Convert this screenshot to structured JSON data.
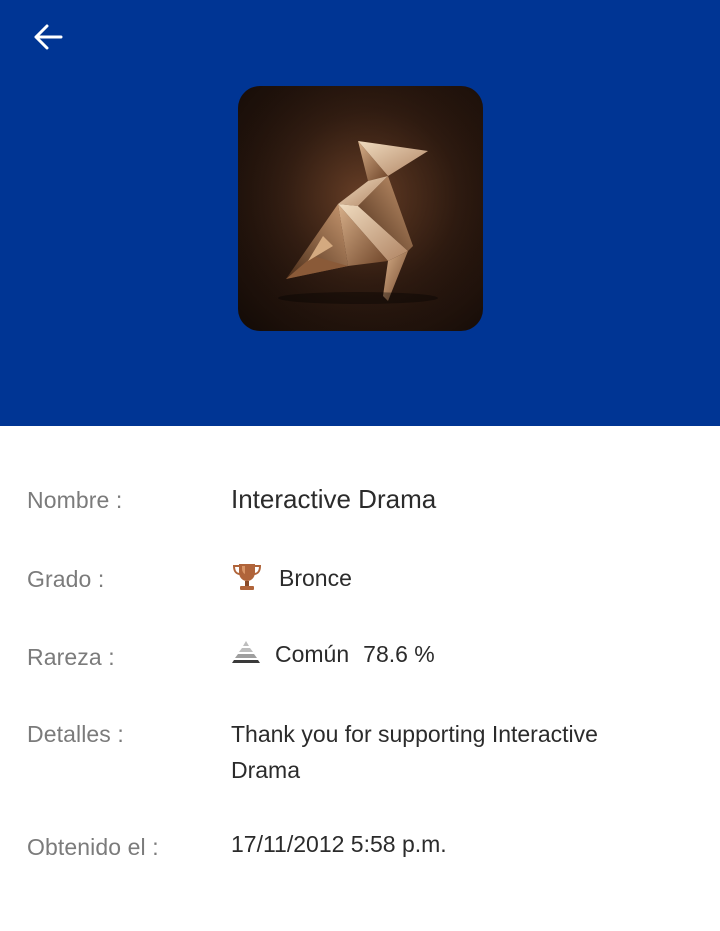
{
  "header": {
    "background": "#003594",
    "back_icon": "arrow-left-icon",
    "trophy_image": "origami-unicorn-trophy-art"
  },
  "fields": {
    "name": {
      "label": "Nombre :",
      "value": "Interactive Drama"
    },
    "grade": {
      "label": "Grado :",
      "value": "Bronce",
      "icon": "bronze-trophy-icon",
      "color": "#b0643a"
    },
    "rarity": {
      "label": "Rareza :",
      "value": "Común",
      "percent": "78.6 %",
      "icon": "pyramid-rarity-icon"
    },
    "details": {
      "label": "Detalles :",
      "value": "Thank you for supporting Interactive Drama"
    },
    "earned": {
      "label": "Obtenido el :",
      "value": "17/11/2012 5:58 p.m."
    }
  }
}
